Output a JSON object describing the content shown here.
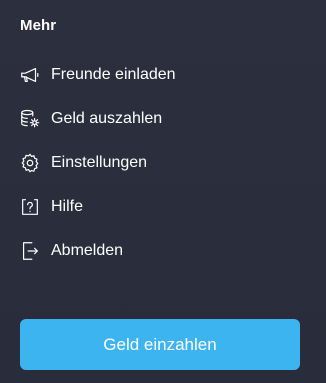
{
  "section": {
    "title": "Mehr"
  },
  "menu": {
    "items": [
      {
        "label": "Freunde einladen",
        "icon": "megaphone-icon"
      },
      {
        "label": "Geld auszahlen",
        "icon": "coins-gear-icon"
      },
      {
        "label": "Einstellungen",
        "icon": "gear-icon"
      },
      {
        "label": "Hilfe",
        "icon": "help-icon"
      },
      {
        "label": "Abmelden",
        "icon": "logout-icon"
      }
    ]
  },
  "cta": {
    "label": "Geld einzahlen"
  },
  "colors": {
    "background": "#2a2d3b",
    "accent": "#3bb4f0",
    "text": "#ffffff"
  }
}
